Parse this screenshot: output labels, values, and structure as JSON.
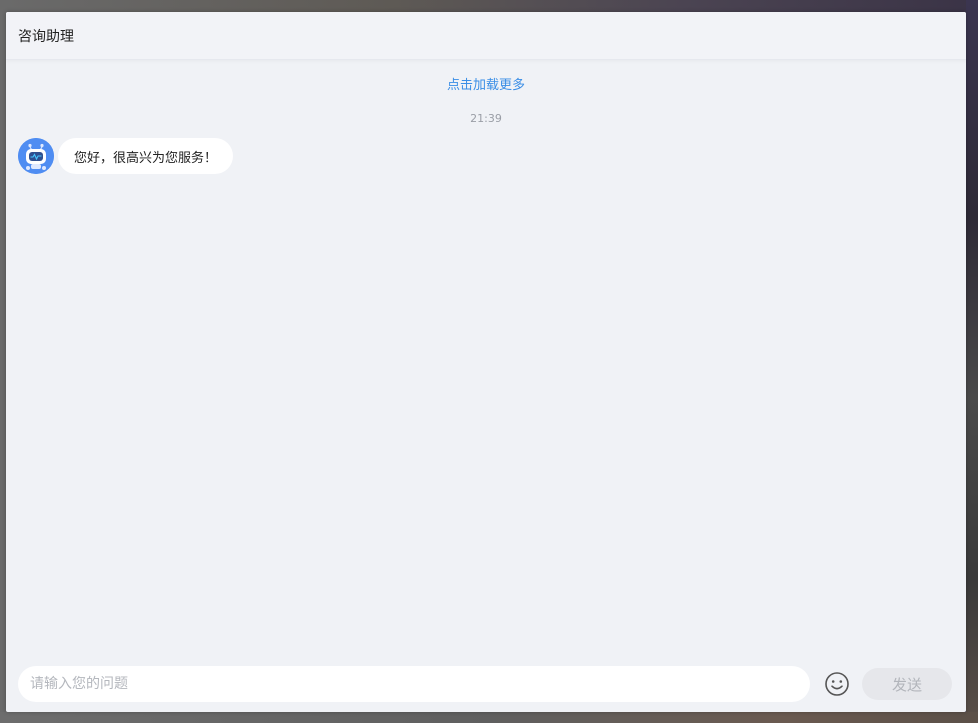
{
  "header": {
    "title": "咨询助理"
  },
  "messages": {
    "load_more": "点击加载更多",
    "timestamp": "21:39",
    "items": [
      {
        "sender": "bot",
        "avatar_icon": "robot-icon",
        "text": "您好，很高兴为您服务！"
      }
    ]
  },
  "input": {
    "placeholder": "请输入您的问题",
    "value": "",
    "emoji_icon": "smiley-icon",
    "send_label": "发送"
  },
  "colors": {
    "link": "#3a8ee6",
    "panel_bg": "#f0f2f6",
    "avatar_bg": "#4f8df2",
    "send_disabled_bg": "#e6e7eb"
  }
}
